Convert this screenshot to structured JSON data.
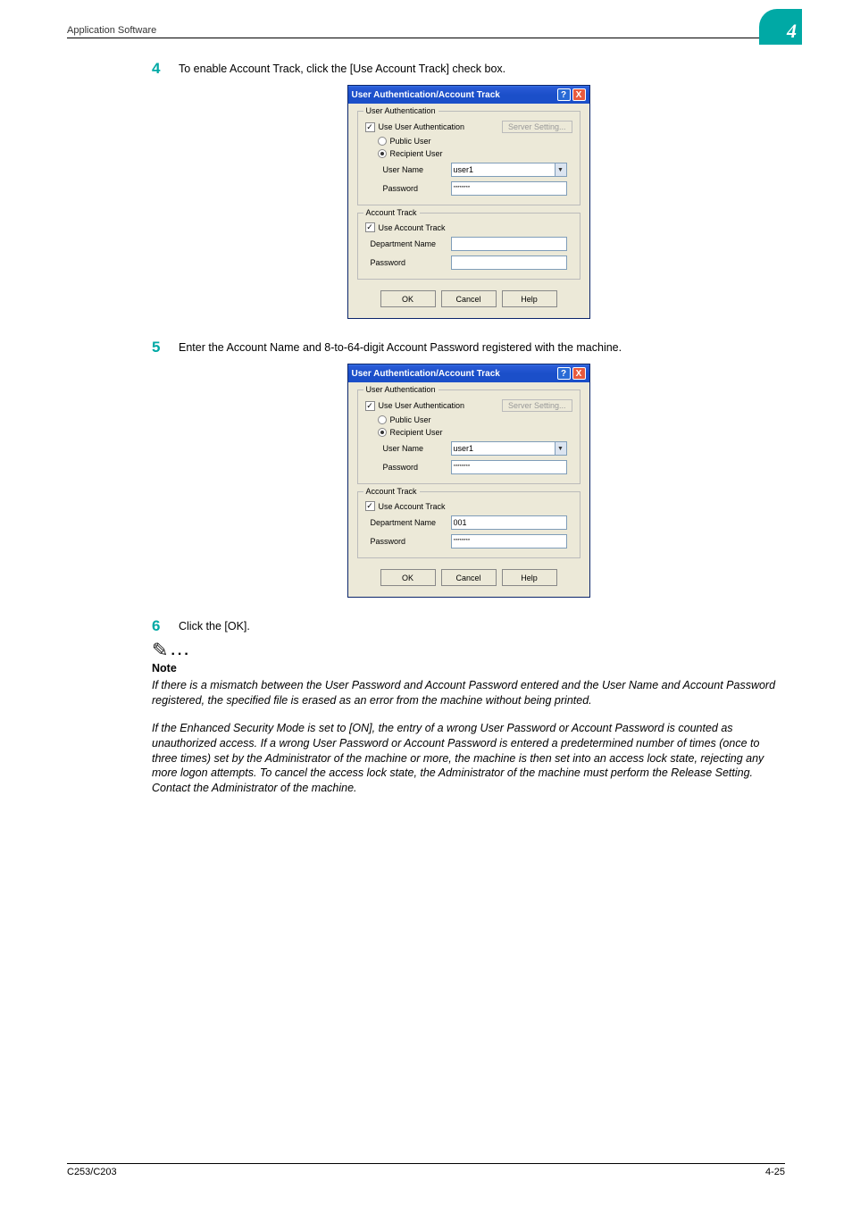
{
  "header": {
    "section": "Application Software",
    "chapter_number": "4"
  },
  "steps": {
    "s4": {
      "num": "4",
      "text": "To enable Account Track, click the [Use Account Track] check box."
    },
    "s5": {
      "num": "5",
      "text": "Enter the Account Name and 8-to-64-digit Account Password registered with the machine."
    },
    "s6": {
      "num": "6",
      "text": "Click the [OK]."
    }
  },
  "dialog_common": {
    "title": "User Authentication/Account Track",
    "help": "?",
    "close": "X",
    "ua_legend": "User Authentication",
    "use_ua": "Use User Authentication",
    "server_setting": "Server Setting...",
    "public_user": "Public User",
    "recipient_user": "Recipient User",
    "user_name_label": "User Name",
    "user_name_value": "user1",
    "password_label": "Password",
    "password_mask": "********",
    "at_legend": "Account Track",
    "use_at": "Use Account Track",
    "dept_label": "Department Name",
    "at_pw_label": "Password",
    "ok": "OK",
    "cancel": "Cancel",
    "help_btn": "Help"
  },
  "dialog2": {
    "dept_value": "001",
    "at_pw_value": "********"
  },
  "note": {
    "heading": "Note",
    "p1": "If there is a mismatch between the User Password and Account Password entered and the User Name and Account Password registered, the specified file is erased as an error from the machine without being printed.",
    "p2": "If the Enhanced Security Mode is set to [ON], the entry of a wrong User Password or Account Password is counted as unauthorized access. If a wrong User Password or Account Password is entered a predetermined number of times (once to three times) set by the Administrator of the machine or more, the machine is then set into an access lock state, rejecting any more logon attempts. To cancel the access lock state, the Administrator of the machine must perform the Release Setting. Contact the Administrator of the machine."
  },
  "footer": {
    "left": "C253/C203",
    "right": "4-25"
  }
}
